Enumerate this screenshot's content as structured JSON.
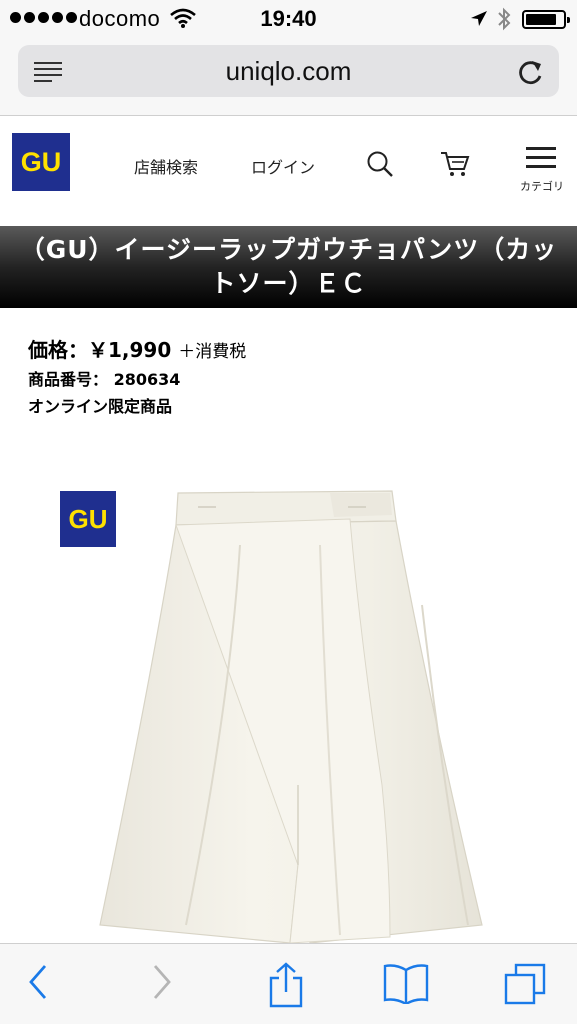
{
  "status_bar": {
    "carrier": "docomo",
    "time": "19:40"
  },
  "browser": {
    "url": "uniqlo.com"
  },
  "header": {
    "logo_text": "GU",
    "nav": {
      "store_search": "店舗検索",
      "login": "ログイン",
      "menu_label": "カテゴリ"
    }
  },
  "product": {
    "title_line1": "（GU）イージーラップガウチョパンツ（カッ",
    "title_line2": "トソー）ＥＣ",
    "price_label": "価格：￥1,990",
    "tax_note": "＋消費税",
    "item_number": "商品番号： 280634",
    "online_only": "オンライン限定商品",
    "image_logo": "GU"
  },
  "colors": {
    "gu_blue": "#1f2f8f",
    "gu_yellow": "#ffe100",
    "ios_blue": "#1a7ae8"
  }
}
